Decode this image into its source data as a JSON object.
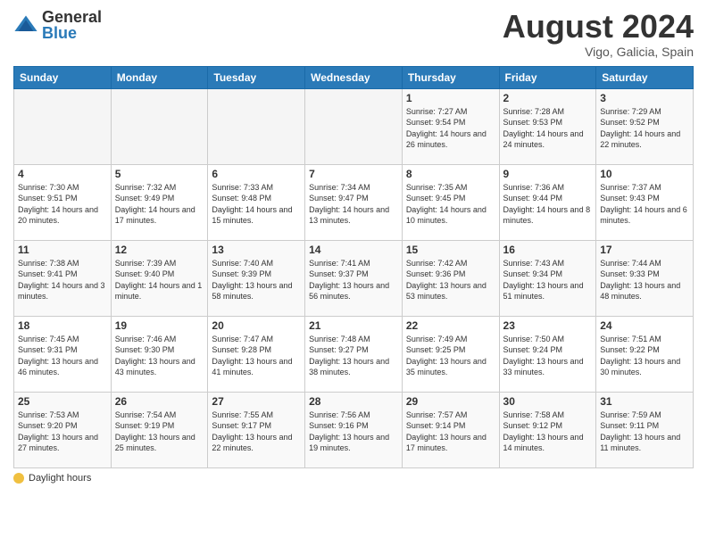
{
  "header": {
    "logo_general": "General",
    "logo_blue": "Blue",
    "month_year": "August 2024",
    "location": "Vigo, Galicia, Spain"
  },
  "weekdays": [
    "Sunday",
    "Monday",
    "Tuesday",
    "Wednesday",
    "Thursday",
    "Friday",
    "Saturday"
  ],
  "weeks": [
    [
      {
        "day": "",
        "info": ""
      },
      {
        "day": "",
        "info": ""
      },
      {
        "day": "",
        "info": ""
      },
      {
        "day": "",
        "info": ""
      },
      {
        "day": "1",
        "info": "Sunrise: 7:27 AM\nSunset: 9:54 PM\nDaylight: 14 hours and 26 minutes."
      },
      {
        "day": "2",
        "info": "Sunrise: 7:28 AM\nSunset: 9:53 PM\nDaylight: 14 hours and 24 minutes."
      },
      {
        "day": "3",
        "info": "Sunrise: 7:29 AM\nSunset: 9:52 PM\nDaylight: 14 hours and 22 minutes."
      }
    ],
    [
      {
        "day": "4",
        "info": "Sunrise: 7:30 AM\nSunset: 9:51 PM\nDaylight: 14 hours and 20 minutes."
      },
      {
        "day": "5",
        "info": "Sunrise: 7:32 AM\nSunset: 9:49 PM\nDaylight: 14 hours and 17 minutes."
      },
      {
        "day": "6",
        "info": "Sunrise: 7:33 AM\nSunset: 9:48 PM\nDaylight: 14 hours and 15 minutes."
      },
      {
        "day": "7",
        "info": "Sunrise: 7:34 AM\nSunset: 9:47 PM\nDaylight: 14 hours and 13 minutes."
      },
      {
        "day": "8",
        "info": "Sunrise: 7:35 AM\nSunset: 9:45 PM\nDaylight: 14 hours and 10 minutes."
      },
      {
        "day": "9",
        "info": "Sunrise: 7:36 AM\nSunset: 9:44 PM\nDaylight: 14 hours and 8 minutes."
      },
      {
        "day": "10",
        "info": "Sunrise: 7:37 AM\nSunset: 9:43 PM\nDaylight: 14 hours and 6 minutes."
      }
    ],
    [
      {
        "day": "11",
        "info": "Sunrise: 7:38 AM\nSunset: 9:41 PM\nDaylight: 14 hours and 3 minutes."
      },
      {
        "day": "12",
        "info": "Sunrise: 7:39 AM\nSunset: 9:40 PM\nDaylight: 14 hours and 1 minute."
      },
      {
        "day": "13",
        "info": "Sunrise: 7:40 AM\nSunset: 9:39 PM\nDaylight: 13 hours and 58 minutes."
      },
      {
        "day": "14",
        "info": "Sunrise: 7:41 AM\nSunset: 9:37 PM\nDaylight: 13 hours and 56 minutes."
      },
      {
        "day": "15",
        "info": "Sunrise: 7:42 AM\nSunset: 9:36 PM\nDaylight: 13 hours and 53 minutes."
      },
      {
        "day": "16",
        "info": "Sunrise: 7:43 AM\nSunset: 9:34 PM\nDaylight: 13 hours and 51 minutes."
      },
      {
        "day": "17",
        "info": "Sunrise: 7:44 AM\nSunset: 9:33 PM\nDaylight: 13 hours and 48 minutes."
      }
    ],
    [
      {
        "day": "18",
        "info": "Sunrise: 7:45 AM\nSunset: 9:31 PM\nDaylight: 13 hours and 46 minutes."
      },
      {
        "day": "19",
        "info": "Sunrise: 7:46 AM\nSunset: 9:30 PM\nDaylight: 13 hours and 43 minutes."
      },
      {
        "day": "20",
        "info": "Sunrise: 7:47 AM\nSunset: 9:28 PM\nDaylight: 13 hours and 41 minutes."
      },
      {
        "day": "21",
        "info": "Sunrise: 7:48 AM\nSunset: 9:27 PM\nDaylight: 13 hours and 38 minutes."
      },
      {
        "day": "22",
        "info": "Sunrise: 7:49 AM\nSunset: 9:25 PM\nDaylight: 13 hours and 35 minutes."
      },
      {
        "day": "23",
        "info": "Sunrise: 7:50 AM\nSunset: 9:24 PM\nDaylight: 13 hours and 33 minutes."
      },
      {
        "day": "24",
        "info": "Sunrise: 7:51 AM\nSunset: 9:22 PM\nDaylight: 13 hours and 30 minutes."
      }
    ],
    [
      {
        "day": "25",
        "info": "Sunrise: 7:53 AM\nSunset: 9:20 PM\nDaylight: 13 hours and 27 minutes."
      },
      {
        "day": "26",
        "info": "Sunrise: 7:54 AM\nSunset: 9:19 PM\nDaylight: 13 hours and 25 minutes."
      },
      {
        "day": "27",
        "info": "Sunrise: 7:55 AM\nSunset: 9:17 PM\nDaylight: 13 hours and 22 minutes."
      },
      {
        "day": "28",
        "info": "Sunrise: 7:56 AM\nSunset: 9:16 PM\nDaylight: 13 hours and 19 minutes."
      },
      {
        "day": "29",
        "info": "Sunrise: 7:57 AM\nSunset: 9:14 PM\nDaylight: 13 hours and 17 minutes."
      },
      {
        "day": "30",
        "info": "Sunrise: 7:58 AM\nSunset: 9:12 PM\nDaylight: 13 hours and 14 minutes."
      },
      {
        "day": "31",
        "info": "Sunrise: 7:59 AM\nSunset: 9:11 PM\nDaylight: 13 hours and 11 minutes."
      }
    ]
  ],
  "footer": {
    "daylight_label": "Daylight hours"
  }
}
